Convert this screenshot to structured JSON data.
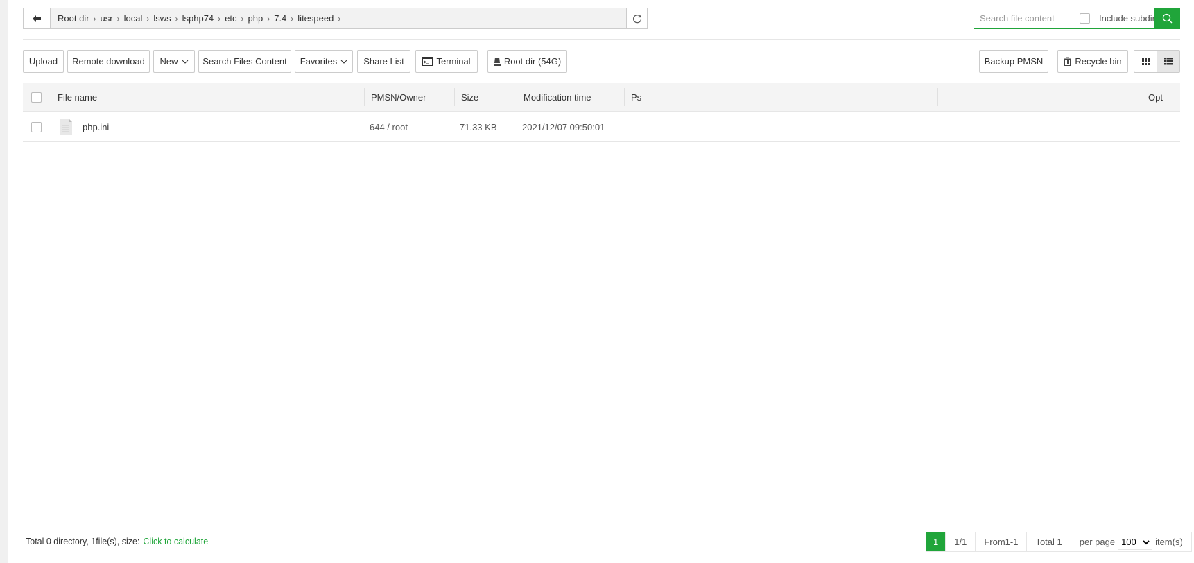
{
  "breadcrumb": {
    "items": [
      "Root dir",
      "usr",
      "local",
      "lsws",
      "lsphp74",
      "etc",
      "php",
      "7.4",
      "litespeed"
    ]
  },
  "search": {
    "placeholder": "Search file content",
    "include_subdir": "Include subdir"
  },
  "toolbar": {
    "upload": "Upload",
    "remote_download": "Remote download",
    "new": "New",
    "search_files_content": "Search Files Content",
    "favorites": "Favorites",
    "share_list": "Share List",
    "terminal": "Terminal",
    "root_dir": "Root dir (54G)",
    "backup_pmsn": "Backup PMSN",
    "recycle_bin": "Recycle bin"
  },
  "table": {
    "headers": {
      "file_name": "File name",
      "pmsn_owner": "PMSN/Owner",
      "size": "Size",
      "modification_time": "Modification time",
      "ps": "Ps",
      "opt": "Opt"
    },
    "rows": [
      {
        "name": "php.ini",
        "pmsn_owner": "644 / root",
        "size": "71.33 KB",
        "modification_time": "2021/12/07 09:50:01",
        "ps": ""
      }
    ]
  },
  "footer": {
    "summary": "Total 0 directory, 1file(s), size:",
    "calculate": "Click to calculate"
  },
  "pager": {
    "current": "1",
    "pages": "1/1",
    "range": "From1-1",
    "total": "Total 1",
    "per_page_label": "per page",
    "per_page": "100",
    "items_label": "item(s)"
  },
  "colors": {
    "accent": "#20a53a"
  }
}
